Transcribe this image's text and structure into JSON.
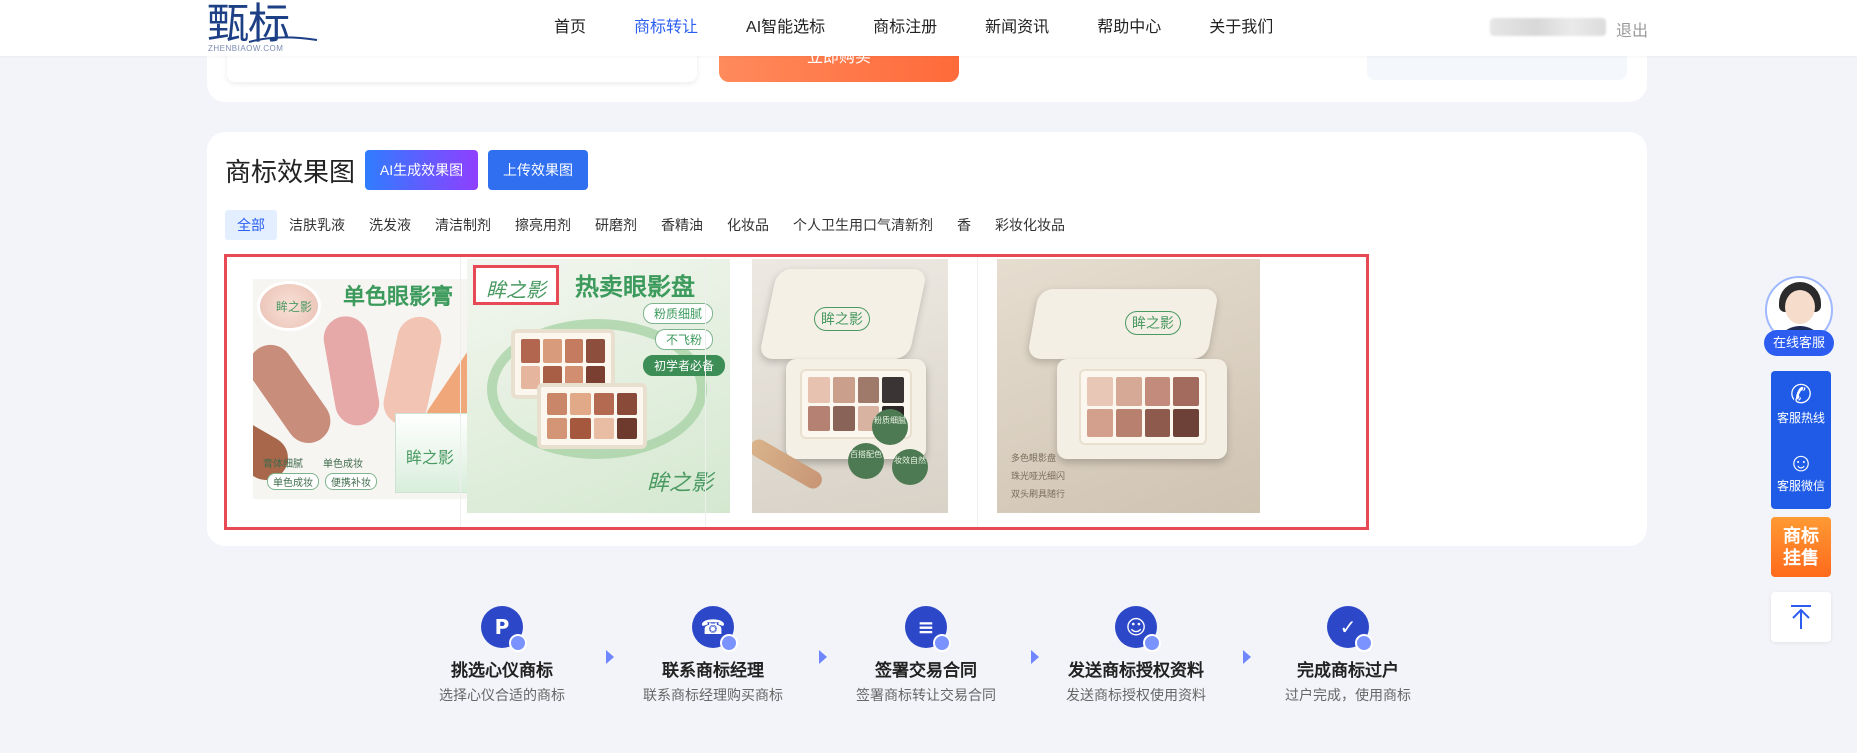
{
  "header": {
    "logo_text": "甄标",
    "logo_sub": "ZHENBIAOW.COM",
    "nav": [
      {
        "label": "首页",
        "active": false
      },
      {
        "label": "商标转让",
        "active": true
      },
      {
        "label": "AI智能选标",
        "active": false
      },
      {
        "label": "商标注册",
        "active": false
      },
      {
        "label": "新闻资讯",
        "active": false
      },
      {
        "label": "帮助中心",
        "active": false
      },
      {
        "label": "关于我们",
        "active": false
      }
    ],
    "logout_label": "退出"
  },
  "upper_card": {
    "buy_label": "立即购买"
  },
  "effects": {
    "title": "商标效果图",
    "ai_button": "AI生成效果图",
    "upload_button": "上传效果图",
    "categories": [
      {
        "label": "全部",
        "active": true
      },
      {
        "label": "洁肤乳液"
      },
      {
        "label": "洗发液"
      },
      {
        "label": "清洁制剂"
      },
      {
        "label": "擦亮用剂"
      },
      {
        "label": "研磨剂"
      },
      {
        "label": "香精油"
      },
      {
        "label": "化妆品"
      },
      {
        "label": "个人卫生用口气清新剂"
      },
      {
        "label": "香"
      },
      {
        "label": "彩妆化妆品"
      }
    ],
    "thumbs": {
      "t1": {
        "brand": "眸之影",
        "title": "单色眼影膏",
        "features": [
          "膏体细腻",
          "单色成妆"
        ],
        "pills": [
          "单色成妆",
          "便携补妆"
        ]
      },
      "t2": {
        "brand": "眸之影",
        "title": "热卖眼影盘",
        "tags": [
          "粉质细腻",
          "不飞粉",
          "初学者必备"
        ]
      },
      "t3": {
        "brand": "眸之影",
        "circles": [
          "粉质细腻",
          "百搭配色",
          "妆效自然"
        ]
      },
      "t4": {
        "brand": "眸之影",
        "features": [
          "多色眼影盘",
          "珠光哑光细闪",
          "双头刷具随行"
        ]
      }
    }
  },
  "steps": [
    {
      "icon": "P",
      "title": "挑选心仪商标",
      "sub": "选择心仪合适的商标"
    },
    {
      "icon": "☎",
      "title": "联系商标经理",
      "sub": "联系商标经理购买商标"
    },
    {
      "icon": "≡",
      "title": "签署交易合同",
      "sub": "签署商标转让交易合同"
    },
    {
      "icon": "☺",
      "title": "发送商标授权资料",
      "sub": "发送商标授权使用资料"
    },
    {
      "icon": "✓",
      "title": "完成商标过户",
      "sub": "过户完成，使用商标"
    }
  ],
  "float": {
    "cs_label": "在线客服",
    "hotline_label": "客服热线",
    "wechat_label": "客服微信",
    "sale_label_1": "商标",
    "sale_label_2": "挂售"
  }
}
